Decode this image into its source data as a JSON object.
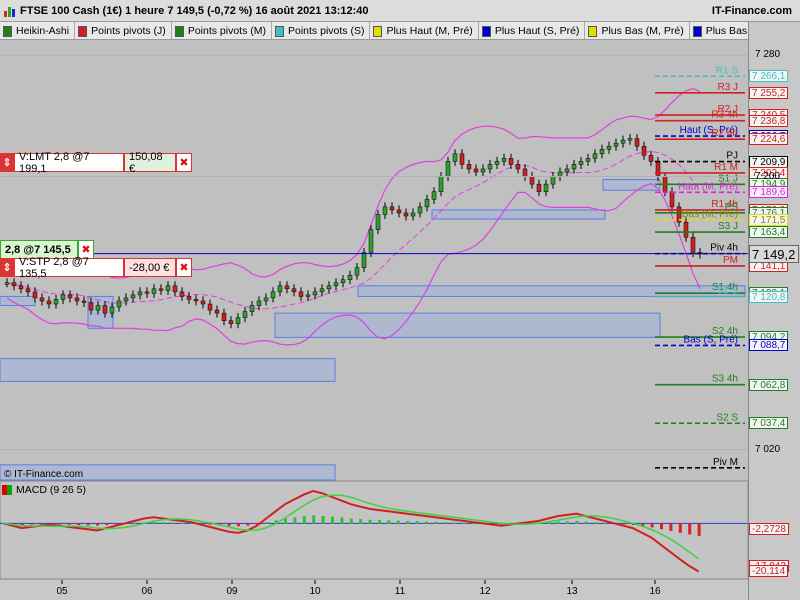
{
  "header": {
    "title": "FTSE 100 Cash (1€) 1 heure 7 149,5 (-0,72 %) 16 août 2021 13:12:40",
    "brand": "IT-Finance.com"
  },
  "legend": [
    {
      "label": "Heikin-Ashi",
      "color": "#208020"
    },
    {
      "label": "Points pivots (J)",
      "color": "#d02020"
    },
    {
      "label": "Points pivots (M)",
      "color": "#208020"
    },
    {
      "label": "Points pivots (S)",
      "color": "#40c0c0"
    },
    {
      "label": "Plus Haut (M, Pré)",
      "color": "#e0e000"
    },
    {
      "label": "Plus Haut (S, Pré)",
      "color": "#0000d0"
    },
    {
      "label": "Plus Bas (M, Pré)",
      "color": "#e0e000"
    },
    {
      "label": "Plus Bas (S, Pré)",
      "color": "#0000d0"
    }
  ],
  "orders": {
    "lmt": {
      "label": "V:LMT  2,8 @7 199,1",
      "pnl": "150,08 €"
    },
    "pos": {
      "label": "2,8 @7 145,5"
    },
    "stp": {
      "label": "V:STP  2,8 @7 135,5",
      "pnl": "-28,00 €"
    }
  },
  "copyright": "© IT-Finance.com",
  "macd_label": "MACD (9 26 5)",
  "price_axis": {
    "ticks": [
      "7 280",
      "7 200",
      "7 020"
    ],
    "current": "7 149,2"
  },
  "levels": [
    {
      "name": "R1 S",
      "value": "7 266,1",
      "color": "#40c0c0",
      "style": "dashed"
    },
    {
      "name": "R3 J",
      "value": "7 255,2",
      "color": "#d02020",
      "style": "solid"
    },
    {
      "name": "R2 J",
      "value": "7 240,5",
      "color": "#d02020",
      "style": "solid"
    },
    {
      "name": "R3 4h",
      "value": "7 236,8",
      "color": "#d02020",
      "style": "solid"
    },
    {
      "name": "Haut (S, Pré)",
      "value": "7 226,7",
      "color": "#0000d0",
      "style": "dashed"
    },
    {
      "name": "R2 4h",
      "value": "7 224,6",
      "color": "#d02020",
      "style": "solid"
    },
    {
      "name": "PJ",
      "value": "7 209,9",
      "color": "#000000",
      "style": "dashed"
    },
    {
      "name": "R1 M",
      "value": "7 202,4",
      "color": "#d02020",
      "style": "solid"
    },
    {
      "name": "S1 J",
      "value": "7 194,9",
      "color": "#208020",
      "style": "solid"
    },
    {
      "name": "Haut (M, Pré)",
      "value": "7 189,6",
      "color": "#e020e0",
      "style": "dashed"
    },
    {
      "name": "R1 4h",
      "value": "7 178,0",
      "color": "#d02020",
      "style": "solid"
    },
    {
      "name": "PS",
      "value": "7 176,1",
      "color": "#208020",
      "style": "solid"
    },
    {
      "name": "Bas (M, Pré)",
      "value": "7 171,5",
      "color": "#e0e000",
      "style": "dashed"
    },
    {
      "name": "S3 J",
      "value": "7 163,4",
      "color": "#208020",
      "style": "solid"
    },
    {
      "name": "Piv 4h",
      "value": "7 149,2",
      "color": "#000000",
      "style": "dashed"
    },
    {
      "name": "PM",
      "value": "7 141,1",
      "color": "#d02020",
      "style": "solid"
    },
    {
      "name": "S1 4h",
      "value": "7 123,1",
      "color": "#208020",
      "style": "solid"
    },
    {
      "name": "S1 S",
      "value": "7 120,8",
      "color": "#40c0c0",
      "style": "dashed"
    },
    {
      "name": "S2 4h",
      "value": "7 094,2",
      "color": "#208020",
      "style": "solid"
    },
    {
      "name": "Bas (S, Pré)",
      "value": "7 088,7",
      "color": "#0000d0",
      "style": "dashed"
    },
    {
      "name": "S3 4h",
      "value": "7 062,8",
      "color": "#208020",
      "style": "solid"
    },
    {
      "name": "S2 S",
      "value": "7 037,4",
      "color": "#208020",
      "style": "dashed"
    },
    {
      "name": "Piv M",
      "value": "",
      "color": "#000000",
      "style": "dashed"
    }
  ],
  "macd_axis": {
    "ticks": [
      "-2,2728",
      "-17,842",
      "-20,114"
    ]
  },
  "x_axis": {
    "labels": [
      "05",
      "06",
      "09",
      "10",
      "11",
      "12",
      "13",
      "16"
    ]
  },
  "chart_data": {
    "type": "candlestick",
    "title": "FTSE 100 Cash (1€) 1 heure",
    "ylim": [
      7000,
      7290
    ],
    "close_series": [
      7130,
      7128,
      7126,
      7124,
      7120,
      7118,
      7116,
      7119,
      7122,
      7120,
      7118,
      7117,
      7112,
      7115,
      7110,
      7114,
      7118,
      7120,
      7122,
      7124,
      7123,
      7126,
      7125,
      7128,
      7124,
      7121,
      7119,
      7118,
      7116,
      7112,
      7110,
      7105,
      7103,
      7107,
      7111,
      7115,
      7118,
      7120,
      7124,
      7128,
      7126,
      7124,
      7121,
      7122,
      7124,
      7126,
      7128,
      7130,
      7132,
      7135,
      7140,
      7150,
      7165,
      7175,
      7180,
      7178,
      7176,
      7174,
      7176,
      7180,
      7185,
      7190,
      7200,
      7210,
      7215,
      7208,
      7205,
      7203,
      7205,
      7208,
      7210,
      7212,
      7208,
      7205,
      7200,
      7195,
      7190,
      7195,
      7200,
      7203,
      7205,
      7208,
      7210,
      7212,
      7215,
      7218,
      7220,
      7222,
      7224,
      7225,
      7220,
      7214,
      7210,
      7200,
      7190,
      7180,
      7170,
      7160,
      7150,
      7149
    ],
    "macd": [
      0.0,
      -1.0,
      -2.0,
      -1.5,
      -1.0,
      -0.5,
      -1.0,
      -1.5,
      -2.0,
      -2.5,
      -3.0,
      -2.0,
      -1.0,
      0.0,
      1.0,
      2.0,
      2.5,
      2.0,
      1.5,
      1.0,
      0.5,
      -0.5,
      -1.5,
      -2.5,
      -3.5,
      -4.0,
      -3.0,
      -1.0,
      2.0,
      5.0,
      8.0,
      10.0,
      12.0,
      13.5,
      12.5,
      11.0,
      9.5,
      8.0,
      7.0,
      6.0,
      5.5,
      5.0,
      4.5,
      4.0,
      3.5,
      3.0,
      2.5,
      2.0,
      1.5,
      1.0,
      0.5,
      0.0,
      -0.5,
      -1.0,
      -0.5,
      0.0,
      0.5,
      1.0,
      2.0,
      3.0,
      3.5,
      4.0,
      3.0,
      2.0,
      1.0,
      0.0,
      -1.0,
      -2.0,
      -4.0,
      -6.0,
      -9.0,
      -12.0,
      -15.0,
      -17.8,
      -20.1
    ],
    "macd_ylim": [
      -22,
      16
    ]
  }
}
